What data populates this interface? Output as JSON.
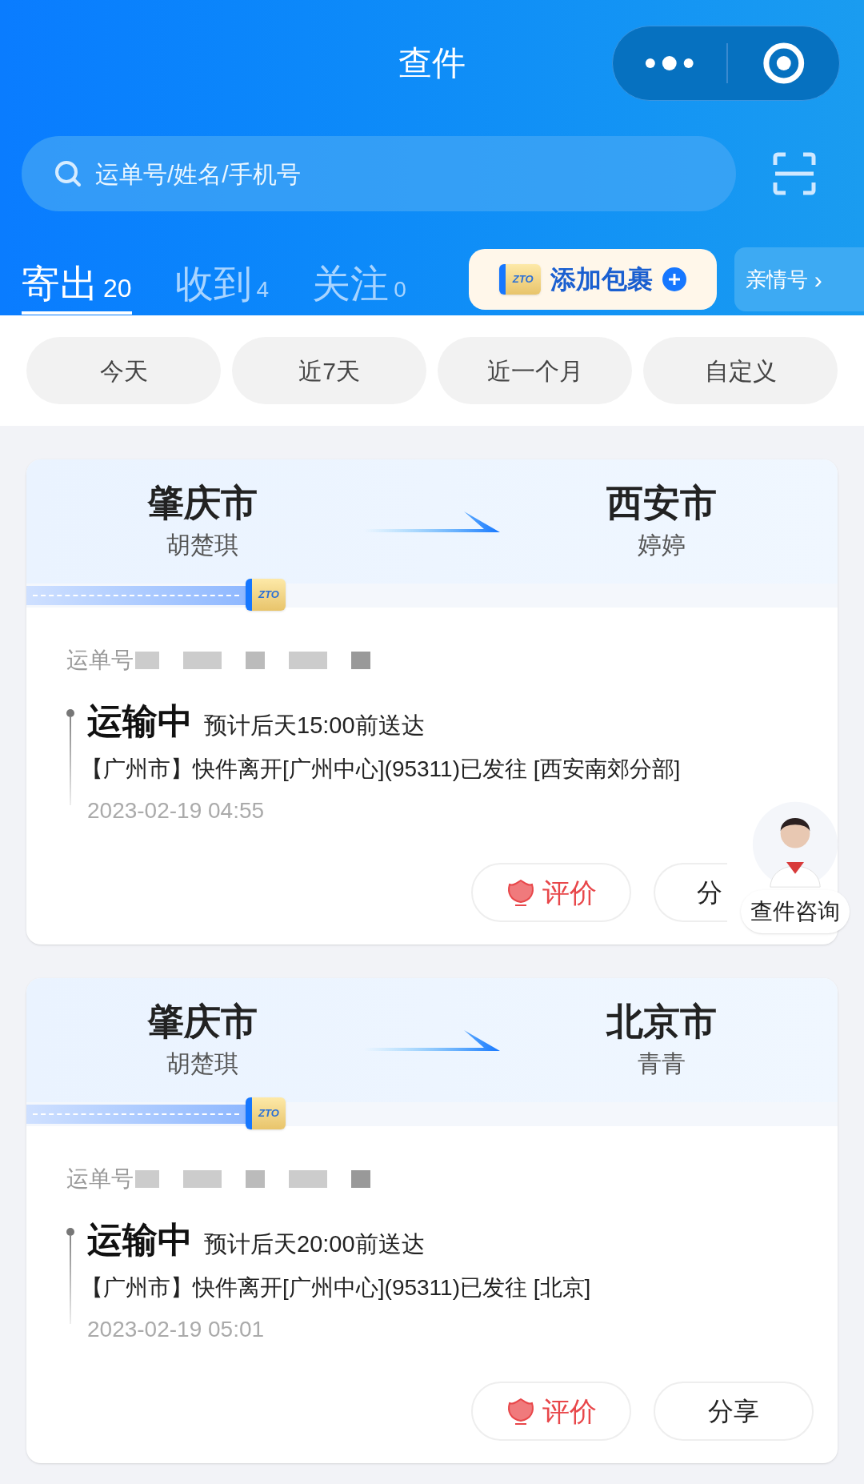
{
  "header": {
    "title": "查件"
  },
  "search": {
    "placeholder": "运单号/姓名/手机号"
  },
  "tabs": [
    {
      "label": "寄出",
      "count": "20",
      "selected": true
    },
    {
      "label": "收到",
      "count": "4",
      "selected": false
    },
    {
      "label": "关注",
      "count": "0",
      "selected": false
    }
  ],
  "add_parcel": {
    "logo": "ZTO",
    "label": "添加包裹"
  },
  "family_link": {
    "label": "亲情号",
    "chevron": "›"
  },
  "date_filters": [
    {
      "label": "今天"
    },
    {
      "label": "近7天"
    },
    {
      "label": "近一个月"
    },
    {
      "label": "自定义"
    }
  ],
  "shipments": [
    {
      "from_city": "肇庆市",
      "sender": "胡楚琪",
      "to_city": "西安市",
      "recipient": "婷婷",
      "courier_logo": "ZTO",
      "waybill_label": "运单号",
      "status": "运输中",
      "eta": "预计后天15:00前送达",
      "latest_event": "【广州市】快件离开[广州中心](95311)已发往 [西安南郊分部]",
      "time": "2023-02-19 04:55",
      "rate_label": "评价",
      "share_label": "分",
      "share_partly_hidden": true
    },
    {
      "from_city": "肇庆市",
      "sender": "胡楚琪",
      "to_city": "北京市",
      "recipient": "青青",
      "courier_logo": "ZTO",
      "waybill_label": "运单号",
      "status": "运输中",
      "eta": "预计后天20:00前送达",
      "latest_event": "【广州市】快件离开[广州中心](95311)已发往 [北京]",
      "time": "2023-02-19 05:01",
      "rate_label": "评价",
      "share_label": "分享",
      "share_partly_hidden": false
    }
  ],
  "support_widget": {
    "label": "查件咨询"
  }
}
